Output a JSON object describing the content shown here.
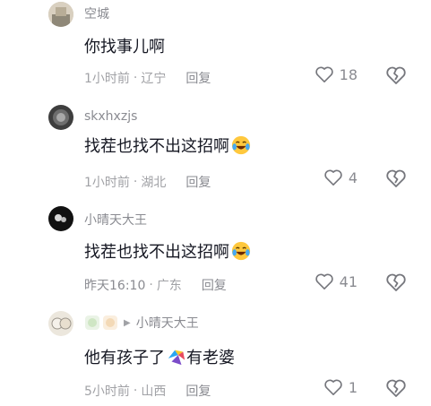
{
  "comments": [
    {
      "username": "空城",
      "text": "你找事儿啊",
      "time": "1小时前",
      "location": "辽宁",
      "reply_label": "回复",
      "likes": "18"
    },
    {
      "username": "skxhxzjs",
      "text": "找茬也找不出这招啊",
      "time": "1小时前",
      "location": "湖北",
      "reply_label": "回复",
      "likes": "4",
      "emoji": "crying-laughing-emoji"
    },
    {
      "username": "小晴天大王",
      "text": "找茬也找不出这招啊",
      "time": "昨天16:10",
      "location": "广东",
      "reply_label": "回复",
      "likes": "41",
      "emoji": "crying-laughing-emoji"
    },
    {
      "username": "小晴天大王",
      "text_before": "他有孩子了",
      "text_after": "有老婆",
      "time": "5小时前",
      "location": "山西",
      "reply_label": "回复",
      "likes": "1",
      "emoji": "colorful-sticker-emoji"
    }
  ],
  "separator": "·"
}
